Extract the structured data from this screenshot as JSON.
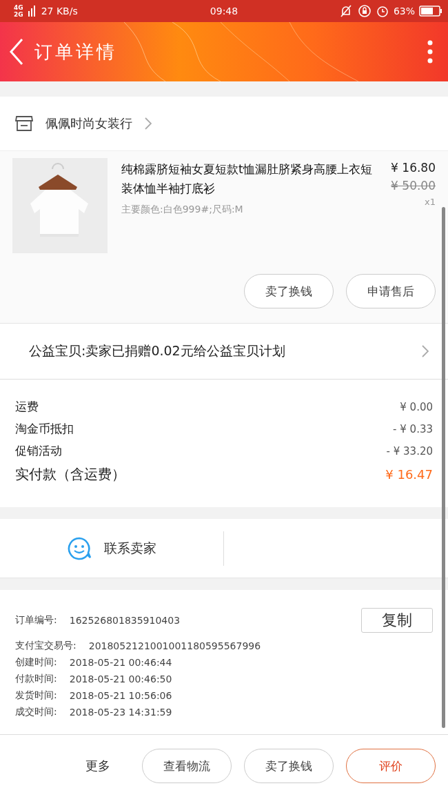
{
  "status_bar": {
    "network_top": "4G",
    "network_bottom": "2G",
    "speed": "27 KB/s",
    "time": "09:48",
    "battery": "63%"
  },
  "header": {
    "title": "订单详情"
  },
  "shop": {
    "name": "佩佩时尚女装行"
  },
  "product": {
    "title": "纯棉露脐短袖女夏短款t恤漏肚脐紧身高腰上衣短装体恤半袖打底衫",
    "specs": "主要颜色:白色999#;尺码:M",
    "price": "¥ 16.80",
    "original_price": "¥ 50.00",
    "quantity": "x1",
    "actions": [
      "卖了换钱",
      "申请售后"
    ]
  },
  "charity": {
    "text": "公益宝贝:卖家已捐赠0.02元给公益宝贝计划"
  },
  "fees": [
    {
      "label": "运费",
      "value": "¥ 0.00",
      "kind": "normal"
    },
    {
      "label": "淘金币抵扣",
      "value": "- ¥ 0.33",
      "kind": "normal"
    },
    {
      "label": "促销活动",
      "value": "- ¥ 33.20",
      "kind": "normal"
    },
    {
      "label": "实付款（含运费）",
      "value": "¥ 16.47",
      "kind": "total"
    }
  ],
  "contact": {
    "label": "联系卖家"
  },
  "order_info": {
    "order_label": "订单编号:",
    "order_number": "162526801835910403",
    "copy_button": "复制",
    "rows": [
      {
        "label": "支付宝交易号:",
        "value": "2018052121001001180595567996"
      },
      {
        "label": "创建时间:",
        "value": "2018-05-21 00:46:44"
      },
      {
        "label": "付款时间:",
        "value": "2018-05-21 00:46:50"
      },
      {
        "label": "发货时间:",
        "value": "2018-05-21 10:56:06"
      },
      {
        "label": "成交时间:",
        "value": "2018-05-23 14:31:59"
      }
    ]
  },
  "bottom_bar": {
    "more": "更多",
    "buttons": [
      {
        "label": "查看物流",
        "kind": "normal"
      },
      {
        "label": "卖了换钱",
        "kind": "normal"
      },
      {
        "label": "评价",
        "kind": "primary"
      }
    ]
  }
}
